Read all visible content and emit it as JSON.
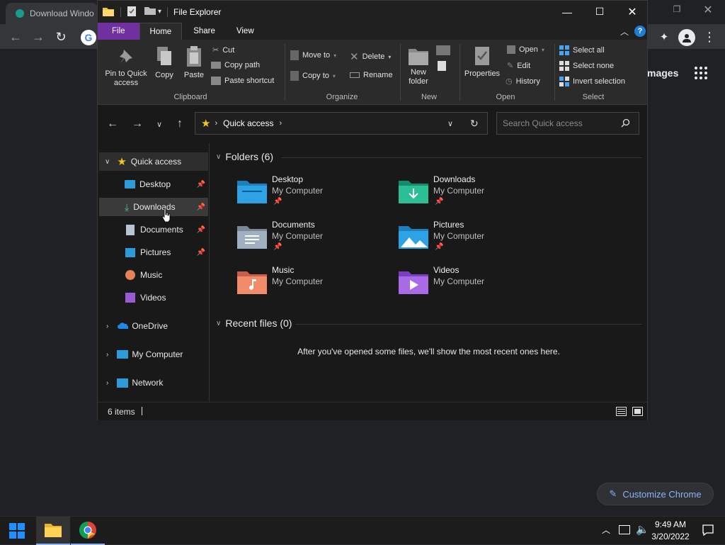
{
  "chrome": {
    "tab_title": "Download Windo",
    "images_link": "mages",
    "customize_label": "Customize Chrome"
  },
  "explorer": {
    "title": "File Explorer",
    "ribbon_tabs": [
      "File",
      "Home",
      "Share",
      "View"
    ],
    "clipboard": {
      "pin": "Pin to Quick access",
      "copy": "Copy",
      "paste": "Paste",
      "cut": "Cut",
      "copy_path": "Copy path",
      "paste_shortcut": "Paste shortcut",
      "label": "Clipboard"
    },
    "organize": {
      "move_to": "Move to",
      "copy_to": "Copy to",
      "delete": "Delete",
      "rename": "Rename",
      "label": "Organize"
    },
    "new": {
      "new_folder": "New folder",
      "label": "New"
    },
    "open": {
      "properties": "Properties",
      "open": "Open",
      "edit": "Edit",
      "history": "History",
      "label": "Open"
    },
    "select": {
      "select_all": "Select all",
      "select_none": "Select none",
      "invert": "Invert selection",
      "label": "Select"
    },
    "address": {
      "location": "Quick access",
      "search_placeholder": "Search Quick access"
    },
    "nav": {
      "quick_access": "Quick access",
      "items": [
        {
          "label": "Desktop",
          "pinned": true
        },
        {
          "label": "Downloads",
          "pinned": true
        },
        {
          "label": "Documents",
          "pinned": true
        },
        {
          "label": "Pictures",
          "pinned": true
        },
        {
          "label": "Music",
          "pinned": false
        },
        {
          "label": "Videos",
          "pinned": false
        }
      ],
      "onedrive": "OneDrive",
      "my_computer": "My Computer",
      "network": "Network"
    },
    "folders_header": "Folders (6)",
    "folders": [
      {
        "name": "Desktop",
        "location": "My Computer",
        "pinned": true
      },
      {
        "name": "Downloads",
        "location": "My Computer",
        "pinned": true
      },
      {
        "name": "Documents",
        "location": "My Computer",
        "pinned": true
      },
      {
        "name": "Pictures",
        "location": "My Computer",
        "pinned": true
      },
      {
        "name": "Music",
        "location": "My Computer",
        "pinned": false
      },
      {
        "name": "Videos",
        "location": "My Computer",
        "pinned": false
      }
    ],
    "recent_header": "Recent files (0)",
    "recent_empty": "After you've opened some files, we'll show the most recent ones here.",
    "status_items": "6 items"
  },
  "taskbar": {
    "time": "9:49 AM",
    "date": "3/20/2022"
  },
  "colors": {
    "file_tab": "#7030a0",
    "accent_blue": "#8ab4f8",
    "folder_blue": "#2d9bd8"
  }
}
